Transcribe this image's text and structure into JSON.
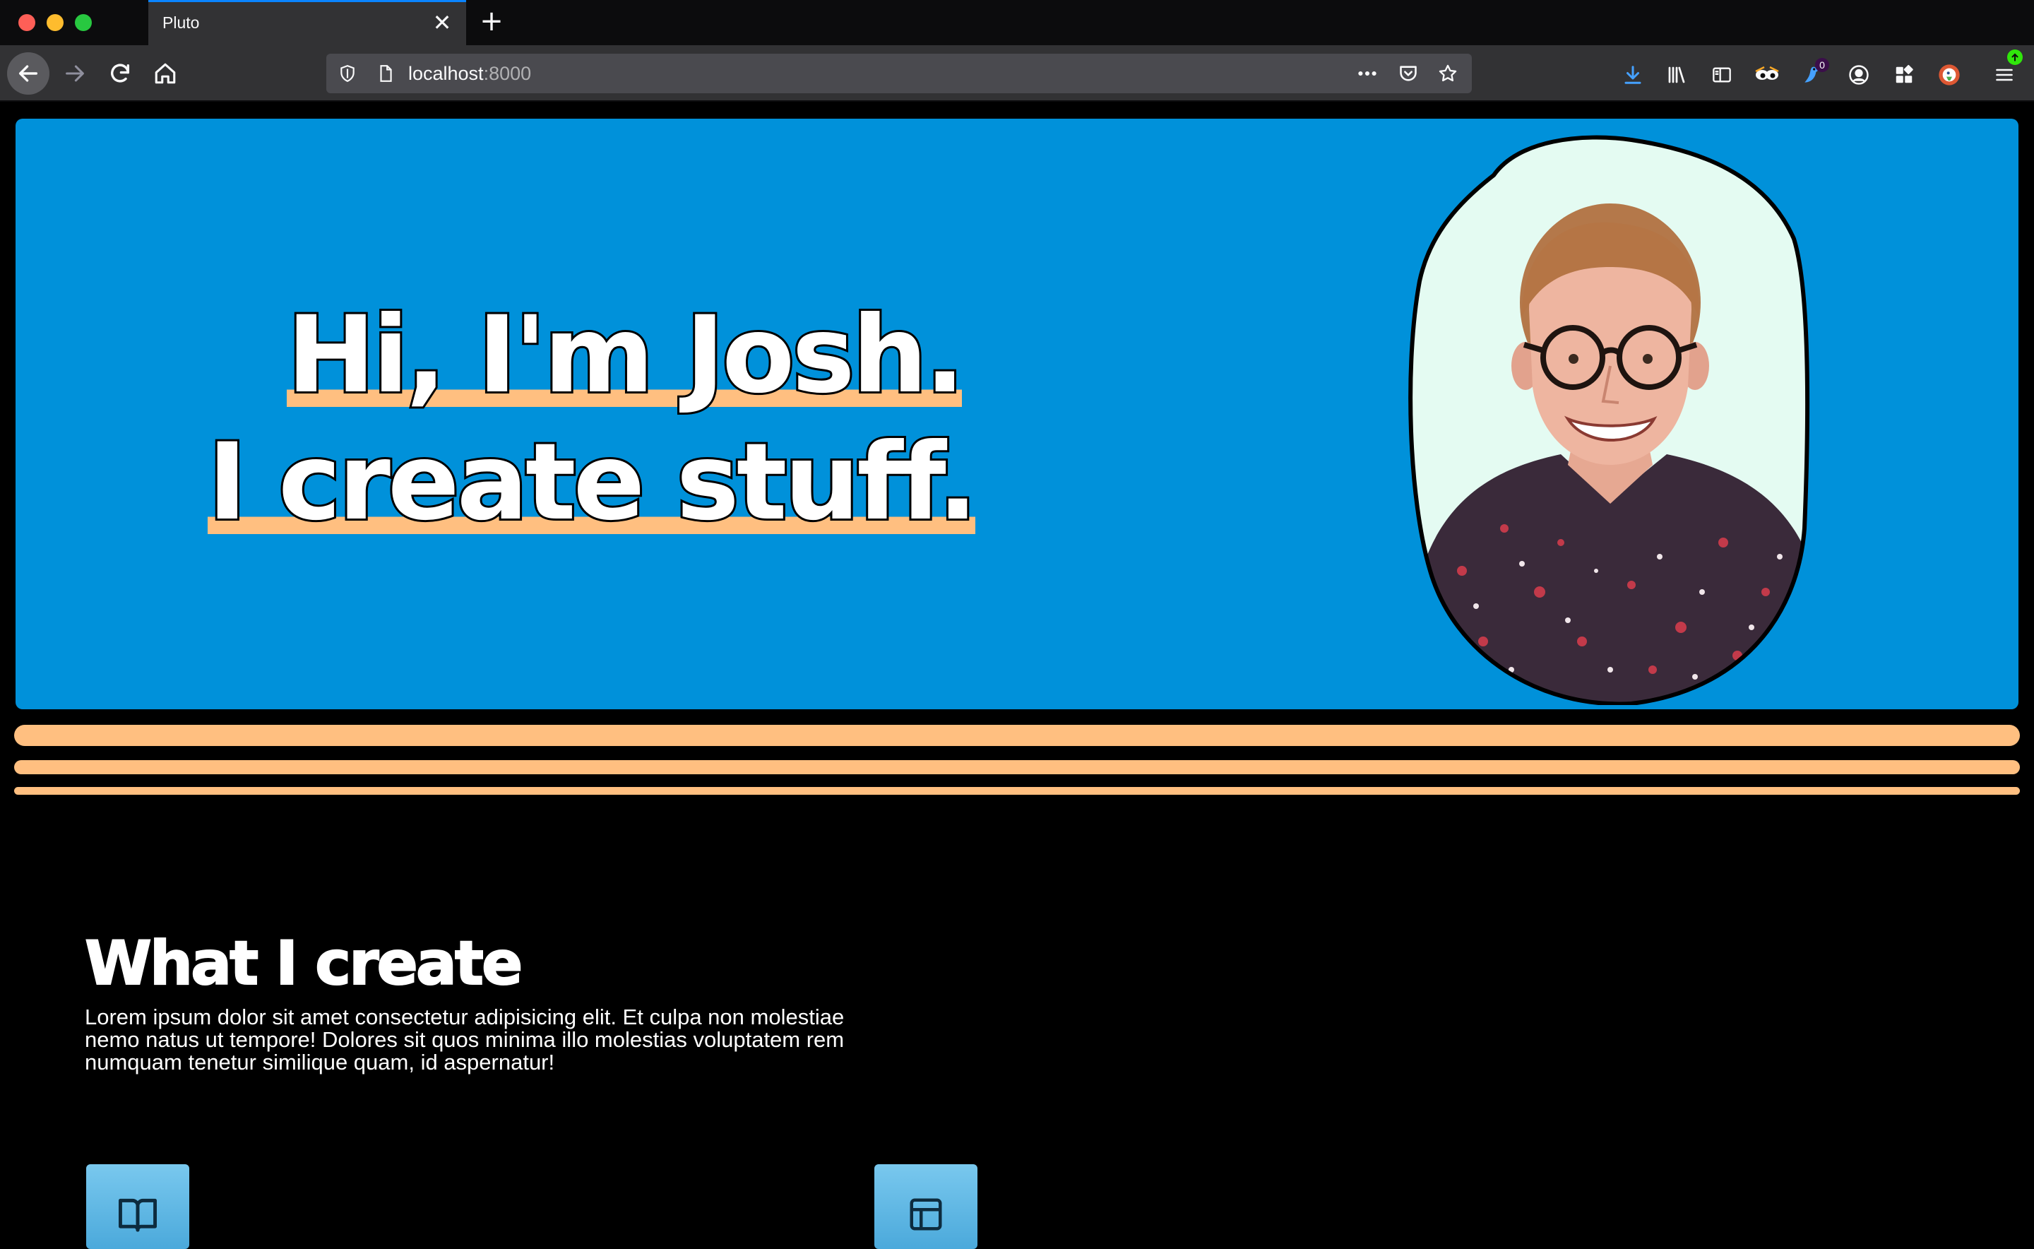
{
  "browser": {
    "tab_title": "Pluto",
    "url_host": "localhost",
    "url_port": ":8000",
    "notification_badge": "0",
    "accent_color": "#0a84ff"
  },
  "hero": {
    "line1": "Hi, I'm Josh.",
    "line2": "I create stuff.",
    "background_color": "#0091da",
    "highlight_color": "#ffbf80",
    "portrait_bg_color": "#e4fbf2"
  },
  "section": {
    "title": "What I create",
    "text": "Lorem ipsum dolor sit amet consectetur adipisicing elit. Et culpa non molestiae nemo natus ut tempore! Dolores sit quos minima illo molestias voluptatem rem numquam tenetur similique quam, id aspernatur!",
    "cards": [
      {
        "icon": "book-icon"
      },
      {
        "icon": "layout-icon"
      }
    ]
  },
  "stripe_color": "#ffbf80"
}
